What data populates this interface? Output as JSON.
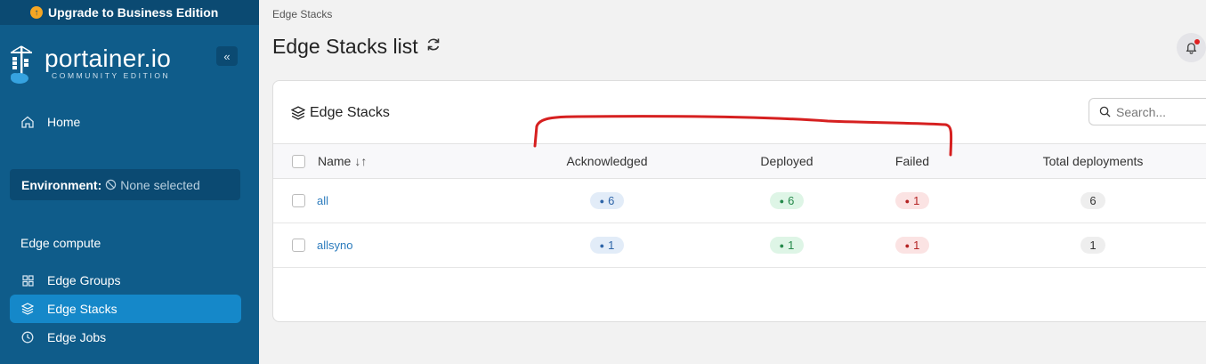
{
  "sidebar": {
    "upgrade_label": "Upgrade to Business Edition",
    "brand_name": "portainer.io",
    "edition": "COMMUNITY EDITION",
    "collapse_glyph": "«",
    "home_label": "Home",
    "environment_label": "Environment:",
    "environment_value": "None selected",
    "section_title": "Edge compute",
    "items": [
      {
        "label": "Edge Groups",
        "icon": "grid-icon"
      },
      {
        "label": "Edge Stacks",
        "icon": "layers-icon",
        "active": true
      },
      {
        "label": "Edge Jobs",
        "icon": "clock-icon"
      }
    ]
  },
  "header": {
    "breadcrumb": "Edge Stacks",
    "title": "Edge Stacks list"
  },
  "card": {
    "title": "Edge Stacks",
    "search_placeholder": "Search...",
    "columns": [
      "Name",
      "Acknowledged",
      "Deployed",
      "Failed",
      "Total deployments"
    ],
    "sort_glyph": "↓↑",
    "rows": [
      {
        "name": "all",
        "acknowledged": "6",
        "deployed": "6",
        "failed": "1",
        "total": "6"
      },
      {
        "name": "allsyno",
        "acknowledged": "1",
        "deployed": "1",
        "failed": "1",
        "total": "1"
      }
    ]
  },
  "colors": {
    "sidebar_bg": "#0f5c8a",
    "active_item": "#1588c9",
    "annotation": "#d62020"
  }
}
